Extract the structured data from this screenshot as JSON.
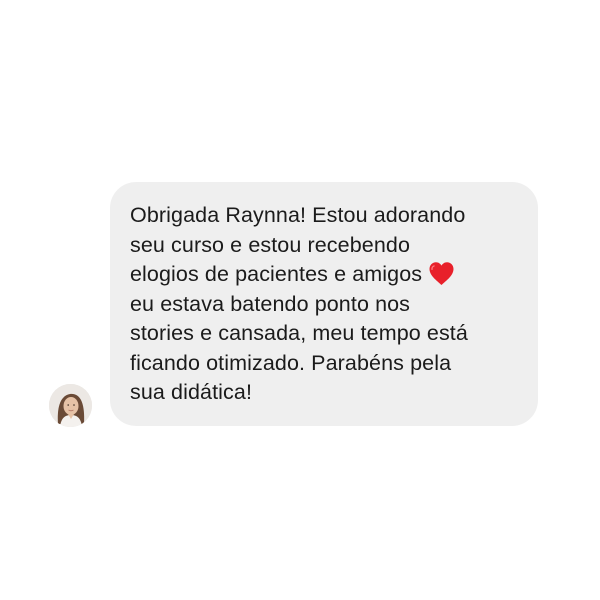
{
  "message": {
    "lines": [
      "Obrigada Raynna! Estou adorando",
      "seu curso e estou recebendo",
      "elogios de pacientes e amigos",
      "eu estava batendo ponto nos",
      "stories e cansada, meu tempo está",
      "ficando otimizado. Parabéns pela",
      "sua didática!"
    ],
    "emoji": "heart-icon",
    "emoji_color": "#e8202a"
  },
  "sender": {
    "avatar": "avatar-photo"
  },
  "colors": {
    "bubble": "#efefef",
    "text": "#1b1b1b",
    "background": "#ffffff"
  }
}
